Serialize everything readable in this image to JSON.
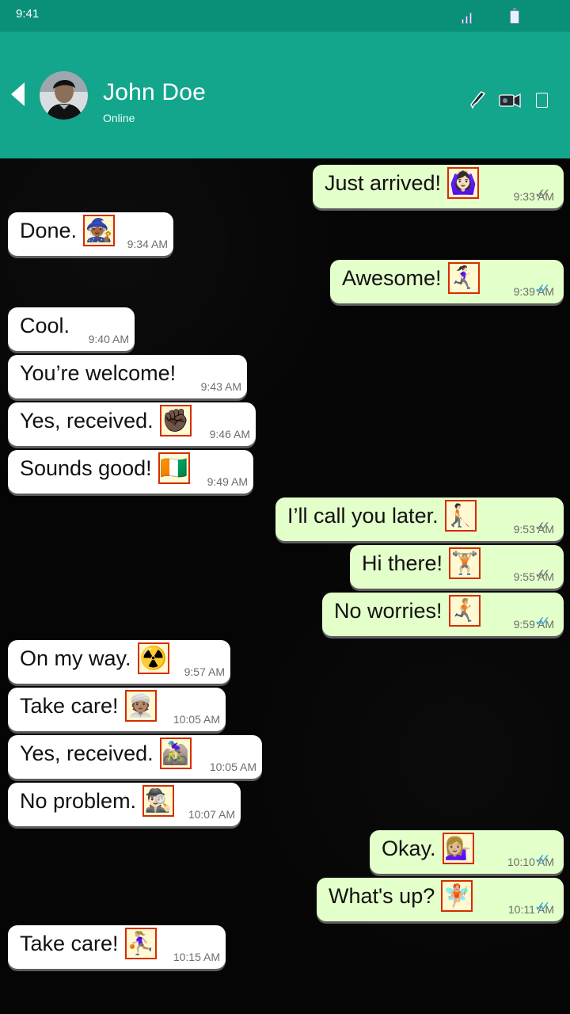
{
  "status_bar": {
    "time": "9:41"
  },
  "header": {
    "contact_name": "John Doe",
    "contact_status": "Online"
  },
  "messages": [
    {
      "type": "sent",
      "text": "Just arrived!",
      "emoji": "🙆🏻‍♀️",
      "time": "9:33 AM",
      "receipt": "delivered",
      "receipt_glyph": "✓✓"
    },
    {
      "type": "received",
      "text": "Done.",
      "emoji": "🧙🏾",
      "time": "9:34 AM"
    },
    {
      "type": "sent",
      "text": "Awesome!",
      "emoji": "🏃🏻‍♀️‍➡️",
      "time": "9:39 AM",
      "receipt": "read",
      "receipt_glyph": "✓✓"
    },
    {
      "type": "received",
      "text": "Cool.",
      "emoji": "",
      "time": "9:40 AM"
    },
    {
      "type": "received",
      "text": "You’re welcome!",
      "emoji": "",
      "time": "9:43 AM"
    },
    {
      "type": "received",
      "text": "Yes, received.",
      "emoji": "✊🏿",
      "time": "9:46 AM"
    },
    {
      "type": "received",
      "text": "Sounds good!",
      "emoji": "🇨🇮",
      "time": "9:49 AM"
    },
    {
      "type": "sent",
      "text": "I’ll call you later.",
      "emoji": "🧑🏻‍🦯‍➡️",
      "time": "9:53 AM",
      "receipt": "delivered",
      "receipt_glyph": "✓✓"
    },
    {
      "type": "sent",
      "text": "Hi there!",
      "emoji": "🏋🏼",
      "time": "9:55 AM",
      "receipt": "delivered",
      "receipt_glyph": "✓✓"
    },
    {
      "type": "sent",
      "text": "No worries!",
      "emoji": "🏃🏼‍➡️",
      "time": "9:59 AM",
      "receipt": "read",
      "receipt_glyph": "✓✓"
    },
    {
      "type": "received",
      "text": "On my way.",
      "emoji": "☢️",
      "time": "9:57 AM"
    },
    {
      "type": "received",
      "text": "Take care!",
      "emoji": "👳🏽",
      "time": "10:05 AM"
    },
    {
      "type": "received",
      "text": "Yes, received.",
      "emoji": "🚵🏻‍♀️",
      "time": "10:05 AM"
    },
    {
      "type": "received",
      "text": "No problem.",
      "emoji": "🕵🏻‍♂️",
      "time": "10:07 AM"
    },
    {
      "type": "sent",
      "text": "Okay.",
      "emoji": "💁🏼‍♀️",
      "time": "10:10 AM",
      "receipt": "read",
      "receipt_glyph": "✓✓"
    },
    {
      "type": "sent",
      "text": "What's up?",
      "emoji": "🧚🏼",
      "time": "10:11 AM",
      "receipt": "read",
      "receipt_glyph": "✓✓"
    },
    {
      "type": "received",
      "text": "Take care!",
      "emoji": "⛹🏼‍♀️",
      "time": "10:15 AM"
    }
  ]
}
